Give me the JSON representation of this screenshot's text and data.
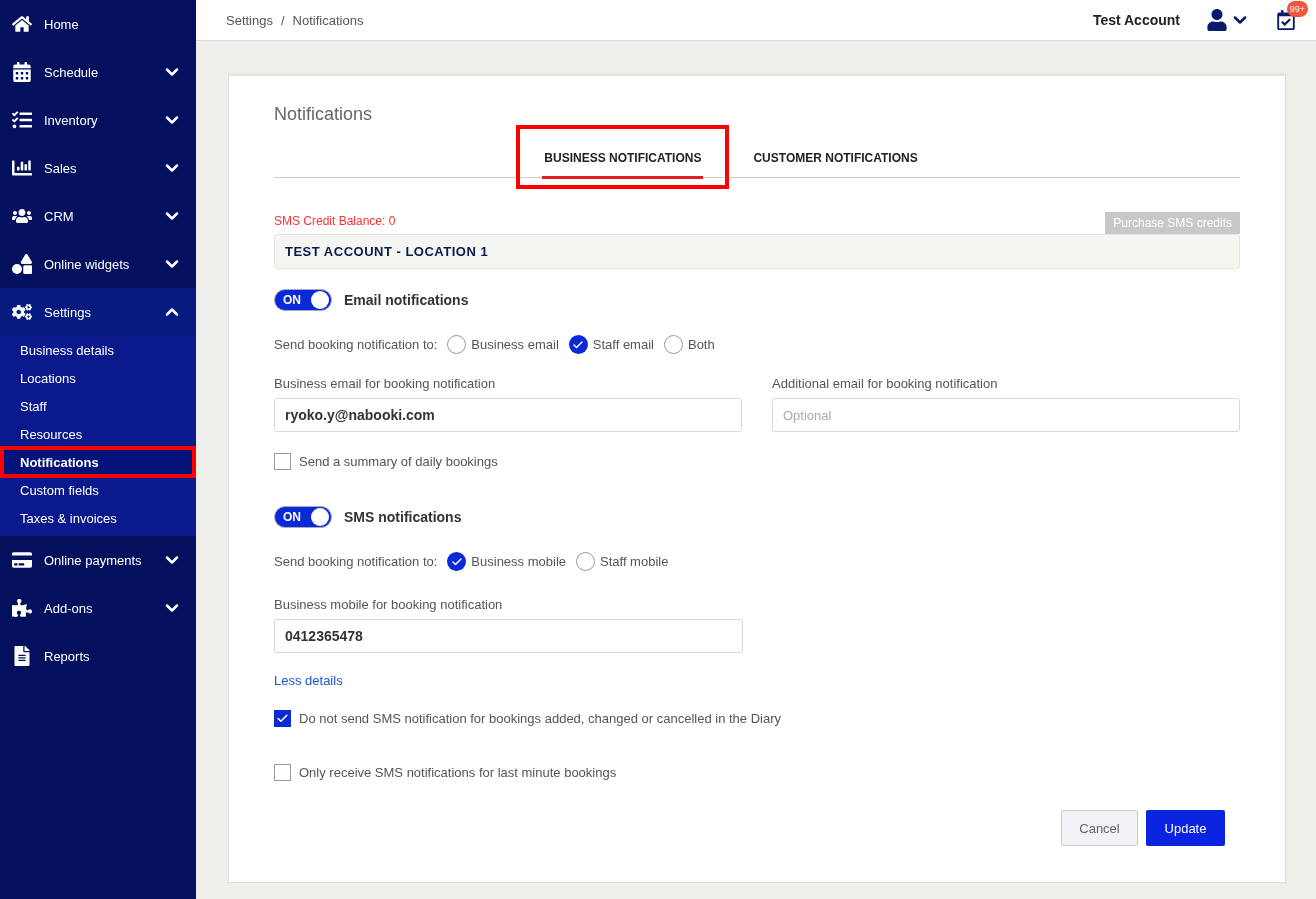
{
  "sidebar": {
    "items": [
      {
        "label": "Home",
        "kind": "link",
        "expanded": false
      },
      {
        "label": "Schedule",
        "kind": "group",
        "expanded": false
      },
      {
        "label": "Inventory",
        "kind": "group",
        "expanded": false
      },
      {
        "label": "Sales",
        "kind": "group",
        "expanded": false
      },
      {
        "label": "CRM",
        "kind": "group",
        "expanded": false
      },
      {
        "label": "Online widgets",
        "kind": "group",
        "expanded": false
      },
      {
        "label": "Settings",
        "kind": "group",
        "expanded": true,
        "children": [
          {
            "label": "Business details",
            "selected": false,
            "highlighted": false
          },
          {
            "label": "Locations",
            "selected": false,
            "highlighted": false
          },
          {
            "label": "Staff",
            "selected": false,
            "highlighted": false
          },
          {
            "label": "Resources",
            "selected": false,
            "highlighted": false
          },
          {
            "label": "Notifications",
            "selected": true,
            "highlighted": true
          },
          {
            "label": "Custom fields",
            "selected": false,
            "highlighted": false
          },
          {
            "label": "Taxes & invoices",
            "selected": false,
            "highlighted": false
          }
        ]
      },
      {
        "label": "Online payments",
        "kind": "group",
        "expanded": false
      },
      {
        "label": "Add-ons",
        "kind": "group",
        "expanded": false
      },
      {
        "label": "Reports",
        "kind": "link",
        "expanded": false
      }
    ]
  },
  "header": {
    "breadcrumb": [
      "Settings",
      "Notifications"
    ],
    "separator": "/",
    "account": "Test Account",
    "badge": "99+"
  },
  "card": {
    "title": "Notifications",
    "tabs": [
      {
        "label": "BUSINESS NOTIFICATIONS",
        "selected": true,
        "highlighted": true
      },
      {
        "label": "CUSTOMER NOTIFICATIONS",
        "selected": false,
        "highlighted": false
      }
    ],
    "sms_balance": "SMS Credit Balance: 0",
    "purchase_button": "Purchase SMS credits",
    "location": "TEST ACCOUNT - LOCATION 1",
    "email": {
      "toggle_label": "ON",
      "on": true,
      "title": "Email notifications",
      "send_to_label": "Send booking notification to:",
      "options": [
        {
          "label": "Business email",
          "selected": false
        },
        {
          "label": "Staff email",
          "selected": true
        },
        {
          "label": "Both",
          "selected": false
        }
      ],
      "business_field": {
        "label": "Business email for booking notification",
        "value": "ryoko.y@nabooki.com"
      },
      "additional_field": {
        "label": "Additional email for booking notification",
        "placeholder": "Optional"
      },
      "summary": {
        "label": "Send a summary of daily bookings",
        "checked": false
      }
    },
    "sms": {
      "toggle_label": "ON",
      "on": true,
      "title": "SMS notifications",
      "send_to_label": "Send booking notification to:",
      "options": [
        {
          "label": "Business mobile",
          "selected": true
        },
        {
          "label": "Staff mobile",
          "selected": false
        }
      ],
      "mobile_field": {
        "label": "Business mobile for booking notification",
        "value": "0412365478"
      },
      "less_details": "Less details",
      "checks": [
        {
          "label": "Do not send SMS notification for bookings added, changed or cancelled in the Diary",
          "checked": true
        },
        {
          "label": "Only receive SMS notifications for last minute bookings",
          "checked": false
        }
      ]
    },
    "buttons": {
      "cancel": "Cancel",
      "update": "Update"
    }
  }
}
